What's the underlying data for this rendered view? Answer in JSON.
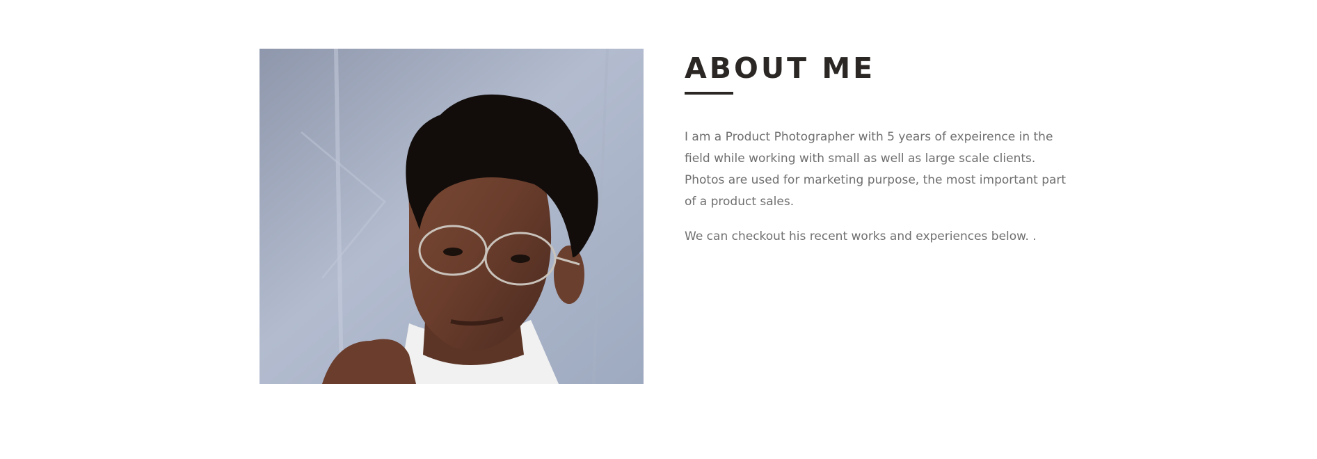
{
  "about": {
    "heading": "ABOUT ME",
    "paragraph_1": "I am a Product Photographer with 5 years of expeirence in the field while working with small as well as large scale clients. Photos are used for marketing purpose, the most important part of a product sales.",
    "paragraph_2": "We can checkout his recent works and experiences below. ."
  },
  "colors": {
    "heading": "#2b2724",
    "body_text": "#6f6f6f",
    "background": "#ffffff",
    "photo_backdrop": "#a9b2c6"
  }
}
